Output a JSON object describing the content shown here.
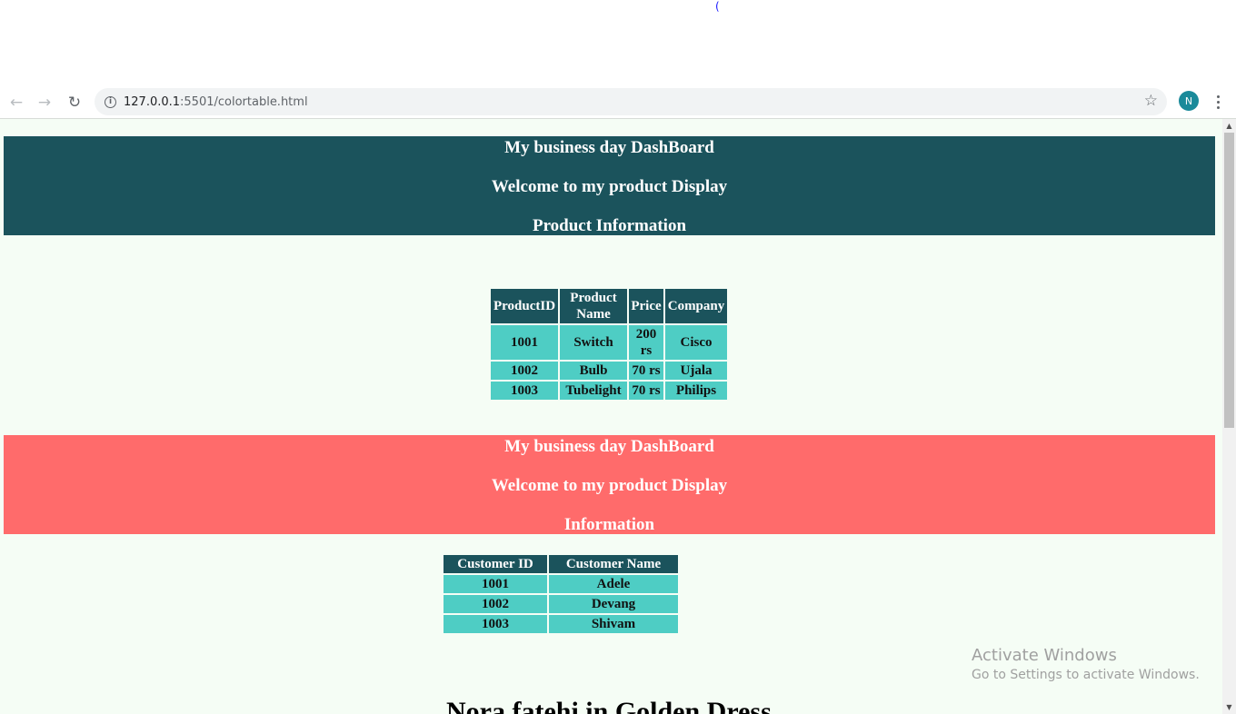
{
  "top_mark": "(",
  "browser": {
    "url_host": "127.0.0.1",
    "url_path": ":5501/colortable.html",
    "avatar_letter": "N"
  },
  "section1": {
    "lines": [
      "My business day DashBoard",
      "Welcome to my product Display",
      "Product Information"
    ],
    "color": "#1b535c"
  },
  "product_table": {
    "headers": [
      "ProductID",
      "Product Name",
      "Price",
      "Company"
    ],
    "rows": [
      [
        "1001",
        "Switch",
        "200 rs",
        "Cisco"
      ],
      [
        "1002",
        "Bulb",
        "70 rs",
        "Ujala"
      ],
      [
        "1003",
        "Tubelight",
        "70 rs",
        "Philips"
      ]
    ]
  },
  "section2": {
    "lines": [
      "My business day DashBoard",
      "Welcome to my product Display",
      "Information"
    ],
    "color": "#ff6b6b"
  },
  "customer_table": {
    "headers": [
      "Customer ID",
      "Customer Name"
    ],
    "rows": [
      [
        "1001",
        "Adele"
      ],
      [
        "1002",
        "Devang"
      ],
      [
        "1003",
        "Shivam"
      ]
    ]
  },
  "bottom_heading": "Nora fatehi in Golden Dress",
  "watermark": {
    "title": "Activate Windows",
    "subtitle": "Go to Settings to activate Windows."
  }
}
